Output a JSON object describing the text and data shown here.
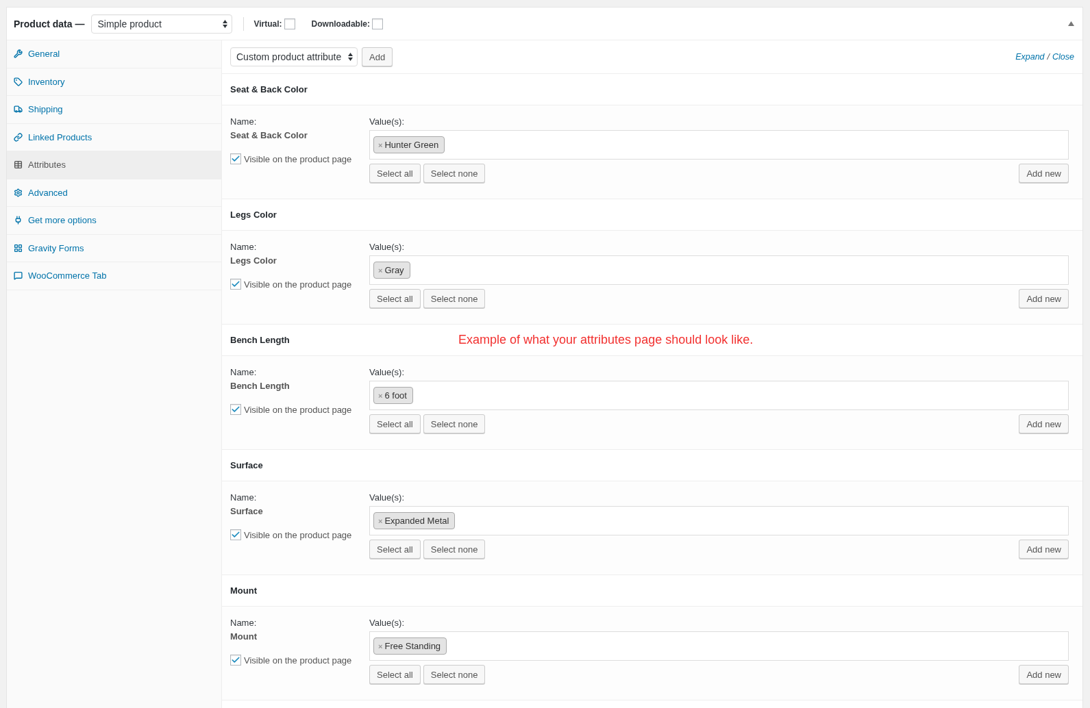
{
  "header": {
    "title": "Product data —",
    "product_type": "Simple product",
    "options": [
      {
        "label": "Virtual:",
        "checked": false
      },
      {
        "label": "Downloadable:",
        "checked": false
      }
    ]
  },
  "sidebar": {
    "items": [
      {
        "label": "General",
        "selected": false
      },
      {
        "label": "Inventory",
        "selected": false
      },
      {
        "label": "Shipping",
        "selected": false
      },
      {
        "label": "Linked Products",
        "selected": false
      },
      {
        "label": "Attributes",
        "selected": true
      },
      {
        "label": "Advanced",
        "selected": false
      },
      {
        "label": "Get more options",
        "selected": false
      },
      {
        "label": "Gravity Forms",
        "selected": false
      },
      {
        "label": "WooCommerce Tab",
        "selected": false
      }
    ]
  },
  "toolbar": {
    "attribute_select": "Custom product attribute",
    "add_button": "Add",
    "expand": "Expand",
    "separator": "/",
    "close": "Close"
  },
  "attributes": [
    {
      "title": "Seat & Back Color",
      "name_label": "Name:",
      "name": "Seat & Back Color",
      "visible": {
        "label": "Visible on the product page",
        "checked": true
      },
      "values_label": "Value(s):",
      "values": [
        {
          "remove": "×",
          "label": "Hunter Green"
        }
      ],
      "buttons": [
        "Select all",
        "Select none"
      ],
      "add_new": "Add new"
    },
    {
      "title": "Legs Color",
      "name_label": "Name:",
      "name": "Legs Color",
      "visible": {
        "label": "Visible on the product page",
        "checked": true
      },
      "values_label": "Value(s):",
      "values": [
        {
          "remove": "×",
          "label": "Gray"
        }
      ],
      "buttons": [
        "Select all",
        "Select none"
      ],
      "add_new": "Add new"
    },
    {
      "title": "Bench Length",
      "note": "Example of what your attributes page should look like.",
      "name_label": "Name:",
      "name": "Bench Length",
      "visible": {
        "label": "Visible on the product page",
        "checked": true
      },
      "values_label": "Value(s):",
      "values": [
        {
          "remove": "×",
          "label": "6 foot"
        }
      ],
      "buttons": [
        "Select all",
        "Select none"
      ],
      "add_new": "Add new"
    },
    {
      "title": "Surface",
      "name_label": "Name:",
      "name": "Surface",
      "visible": {
        "label": "Visible on the product page",
        "checked": true
      },
      "values_label": "Value(s):",
      "values": [
        {
          "remove": "×",
          "label": "Expanded Metal"
        }
      ],
      "buttons": [
        "Select all",
        "Select none"
      ],
      "add_new": "Add new"
    },
    {
      "title": "Mount",
      "name_label": "Name:",
      "name": "Mount",
      "visible": {
        "label": "Visible on the product page",
        "checked": true
      },
      "values_label": "Value(s):",
      "values": [
        {
          "remove": "×",
          "label": "Free Standing"
        }
      ],
      "buttons": [
        "Select all",
        "Select none"
      ],
      "add_new": "Add new"
    }
  ]
}
